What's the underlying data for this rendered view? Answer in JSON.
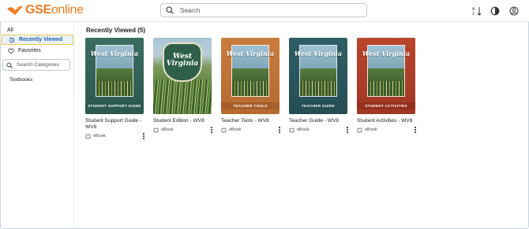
{
  "header": {
    "logo_brand": "GSE",
    "logo_suffix": "online",
    "search_placeholder": "Search",
    "icons": [
      "sort-icon",
      "contrast-icon",
      "account-icon"
    ]
  },
  "sidebar": {
    "items": [
      {
        "label": "All",
        "icon": ""
      },
      {
        "label": "Recently Viewed",
        "icon": "history-icon"
      },
      {
        "label": "Favorites",
        "icon": "heart-icon"
      }
    ],
    "category_search_placeholder": "Search Categories",
    "categories": [
      "Textbooks"
    ]
  },
  "main": {
    "section_title": "Recently Viewed (5)",
    "cards": [
      {
        "title": "Student Support Guide - WV8",
        "type": "eBook",
        "cover_label": "STUDENT SUPPORT GUIDE",
        "cover_text": "West Virginia"
      },
      {
        "title": "Student Edition - WV8",
        "type": "eBook",
        "cover_label": "",
        "cover_text": "West Virginia"
      },
      {
        "title": "Teacher Tools - WV8",
        "type": "eBook",
        "cover_label": "TEACHER TOOLS",
        "cover_text": "West Virginia"
      },
      {
        "title": "Teacher Guide - WV8",
        "type": "eBook",
        "cover_label": "TEACHER GUIDE",
        "cover_text": "West Virginia"
      },
      {
        "title": "Student Activities - WV8",
        "type": "eBook",
        "cover_label": "STUDENT ACTIVITIES",
        "cover_text": "West Virginia"
      }
    ]
  },
  "colors": {
    "brand_orange": "#ef7d22",
    "active_highlight": "#f2c94c",
    "active_text": "#1f5fa8"
  }
}
